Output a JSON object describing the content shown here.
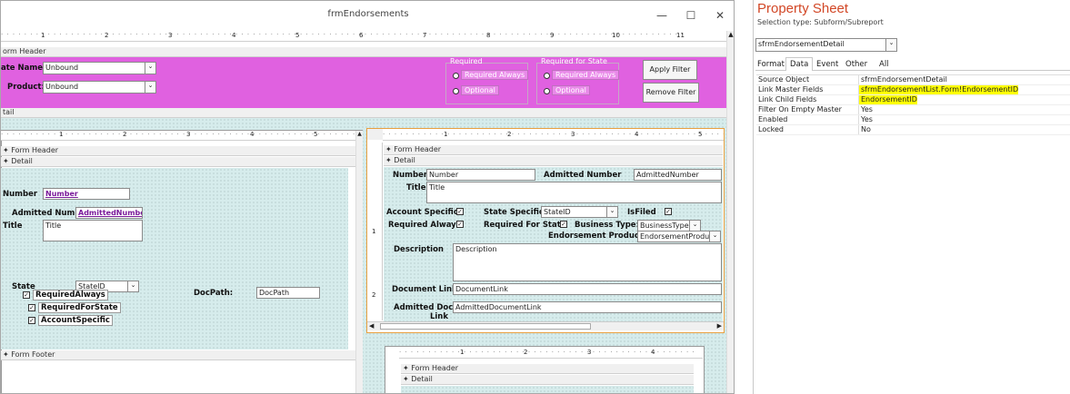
{
  "window": {
    "title": "frmEndorsements",
    "min": "—",
    "max": "☐",
    "close": "✕"
  },
  "main": {
    "ruler_nums": [
      "1",
      "2",
      "3",
      "4",
      "5",
      "6",
      "7",
      "8",
      "9",
      "10",
      "11"
    ],
    "form_header": "orm Header",
    "detail": "tail",
    "state_name_label": "ate Name:",
    "state_name_value": "Unbound",
    "product_label": "Product:",
    "product_value": "Unbound",
    "required_title": "Required",
    "required_for_state_title": "Required for State",
    "opt_required_always": "Required Always",
    "opt_optional": "Optional",
    "apply_filter": "Apply Filter",
    "remove_filter": "Remove Filter"
  },
  "left_sub": {
    "ruler_nums": [
      "1",
      "2",
      "3",
      "4",
      "5"
    ],
    "form_header": "Form Header",
    "detail": "Detail",
    "form_footer": "Form Footer",
    "number_label": "Number",
    "number_value": "Number",
    "admitted_label": "Admitted Numb",
    "admitted_value": "AdmittedNumber",
    "title_label": "Title",
    "title_value": "Title",
    "state_label": "State",
    "state_value": "StateID",
    "docpath_label": "DocPath:",
    "docpath_value": "DocPath",
    "chk_required_always": "RequiredAlways",
    "chk_required_for_state": "RequiredForState",
    "chk_account_specific": "AccountSpecific"
  },
  "right_sub": {
    "ruler_nums": [
      "1",
      "2",
      "3",
      "4",
      "5"
    ],
    "form_header": "Form Header",
    "detail": "Detail",
    "number_label": "Number",
    "number_value": "Number",
    "admitted_label": "Admitted Number",
    "admitted_value": "AdmittedNumber",
    "title_label": "Title",
    "title_value": "Title",
    "account_specific_label": "Account Specific",
    "state_specific_label": "State Specific",
    "state_value": "StateID",
    "is_filed_label": "IsFiled",
    "required_always_label": "Required Always",
    "required_for_state_label": "Required For State",
    "business_type_label": "Business Type:",
    "business_type_value": "BusinessTypeID",
    "endorsement_product_label": "Endorsement Product:",
    "endorsement_product_value": "EndorsementProductI",
    "description_label": "Description",
    "description_value": "Description",
    "document_link_label": "Document Link",
    "document_link_value": "DocumentLink",
    "admitted_doc_label1": "Admitted Doc",
    "admitted_doc_label2": "Link",
    "admitted_doc_value": "AdmittedDocumentLink",
    "vruler": [
      "1",
      "2"
    ]
  },
  "bottom_sub": {
    "ruler_nums": [
      "1",
      "2",
      "3",
      "4"
    ],
    "form_header": "Form Header",
    "detail": "Detail"
  },
  "property_sheet": {
    "title": "Property Sheet",
    "selection_type": "Selection type:  Subform/Subreport",
    "object": "sfrmEndorsementDetail",
    "tabs": [
      "Format",
      "Data",
      "Event",
      "Other",
      "All"
    ],
    "active_tab": "Data",
    "rows": [
      {
        "name": "Source Object",
        "value": "sfrmEndorsementDetail"
      },
      {
        "name": "Link Master Fields",
        "value": "sfrmEndorsementList.Form!EndorsementID"
      },
      {
        "name": "Link Child Fields",
        "value": "EndorsementID"
      },
      {
        "name": "Filter On Empty Master",
        "value": "Yes"
      },
      {
        "name": "Enabled",
        "value": "Yes"
      },
      {
        "name": "Locked",
        "value": "No"
      }
    ]
  },
  "colors": {
    "accent": "#d24726",
    "header_magenta": "#e061e0",
    "highlight": "#ffff00",
    "grid": "#d6ecec"
  }
}
